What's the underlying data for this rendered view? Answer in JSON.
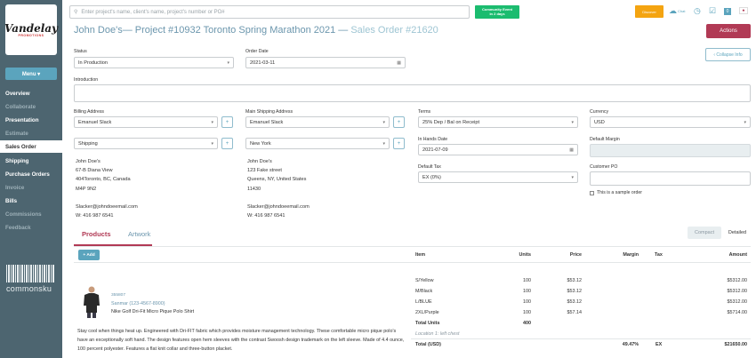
{
  "brand": {
    "logo_text": "Vandelay",
    "logo_sub": "PROMOTIONS",
    "platform": "commonsku"
  },
  "sidebar": {
    "menu_label": "Menu ▾",
    "items": [
      {
        "label": "Overview",
        "state": "normal"
      },
      {
        "label": "Collaborate",
        "state": "muted"
      },
      {
        "label": "Presentation",
        "state": "normal"
      },
      {
        "label": "Estimate",
        "state": "muted"
      },
      {
        "label": "Sales Order",
        "state": "active"
      },
      {
        "label": "Shipping",
        "state": "normal"
      },
      {
        "label": "Purchase Orders",
        "state": "normal"
      },
      {
        "label": "Invoice",
        "state": "muted"
      },
      {
        "label": "Bills",
        "state": "normal"
      },
      {
        "label": "Commissions",
        "state": "muted"
      },
      {
        "label": "Feedback",
        "state": "muted"
      }
    ]
  },
  "topbar": {
    "search_placeholder": "Enter project's name, client's name, project's number or PO#",
    "community_line1": "Community Event",
    "community_line2": "in 2 days",
    "discover": "Discover",
    "chat": "Chat",
    "badge_count": "0"
  },
  "header": {
    "client": "John Doe's",
    "project": "— Project #10932 Toronto Spring Marathon 2021 —",
    "sales_order": "Sales Order #21620",
    "actions": "Actions",
    "collapse": "‹ Collapse Info"
  },
  "form": {
    "status_label": "Status",
    "status_value": "In Production",
    "order_date_label": "Order Date",
    "order_date_value": "2021-03-11",
    "intro_label": "Introduction",
    "billing_label": "Billing Address",
    "billing_contact": "Emanuel Slack",
    "billing_ship": "Shipping",
    "main_ship_label": "Main Shipping Address",
    "ship_contact": "Emanuel Slack",
    "ship_city": "New York",
    "terms_label": "Terms",
    "terms_value": "25% Dep / Bal on Receipt",
    "in_hands_label": "In Hands Date",
    "in_hands_value": "2021-07-09",
    "tax_label": "Default Tax",
    "tax_value": "EX (0%)",
    "currency_label": "Currency",
    "currency_value": "USD",
    "margin_label": "Default Margin",
    "customer_po_label": "Customer PO",
    "sample_label": "This is a sample order",
    "billing_address": "John Doe's\n67-B Diana View\n404Toronto, BC, Canada\nM4P 9N2\n\nSlacker@johndoeemail.com\nW: 416 987 6541",
    "shipping_address": "John Doe's\n123 Fake street\nQueens, NY, United States\n11430\n\nSlacker@johndoeemail.com\nW: 416 987 6541"
  },
  "tabs": {
    "products": "Products",
    "artwork": "Artwork",
    "compact": "Compact",
    "detailed": "Detailed"
  },
  "table": {
    "add_label": "+ Add",
    "headers": {
      "item": "Item",
      "units": "Units",
      "price": "Price",
      "margin": "Margin",
      "tax": "Tax",
      "amount": "Amount"
    },
    "product": {
      "sku": "355807",
      "supplier": "Sanmar (123-4567-8900)",
      "name": "Nike Golf Dri-Fit Micro Pique Polo Shirt",
      "description": "Stay cool when things heat up. Engineered with Dri-FIT fabric which provides moisture management technology. These comfortable micro pique polo's have an exceptionally soft hand. The design features open hem sleeves with the contrast Swoosh design trademark on the left sleeve. Made of 4.4 ounce, 100 percent polyester. Features a flat knit collar and three-button placket."
    },
    "rows": [
      {
        "item": "S/Yellow",
        "units": "100",
        "price": "$53.12",
        "amount": "$5312.00"
      },
      {
        "item": "M/Black",
        "units": "100",
        "price": "$53.12",
        "amount": "$5312.00"
      },
      {
        "item": "L/BLUE",
        "units": "100",
        "price": "$53.12",
        "amount": "$5312.00"
      },
      {
        "item": "2XL/Purple",
        "units": "100",
        "price": "$57.14",
        "amount": "$5714.00"
      }
    ],
    "total_units_label": "Total Units",
    "total_units": "400",
    "location": "Location 1: left chest",
    "total_label": "Total (USD)",
    "total_margin": "49.47%",
    "total_tax": "EX",
    "total_amount": "$21650.00"
  },
  "colors": {
    "sidebar": "#4d6570",
    "accent": "#5ba4bd",
    "brand": "#b13a55",
    "community": "#1bbc6f",
    "discover": "#f4a411"
  }
}
